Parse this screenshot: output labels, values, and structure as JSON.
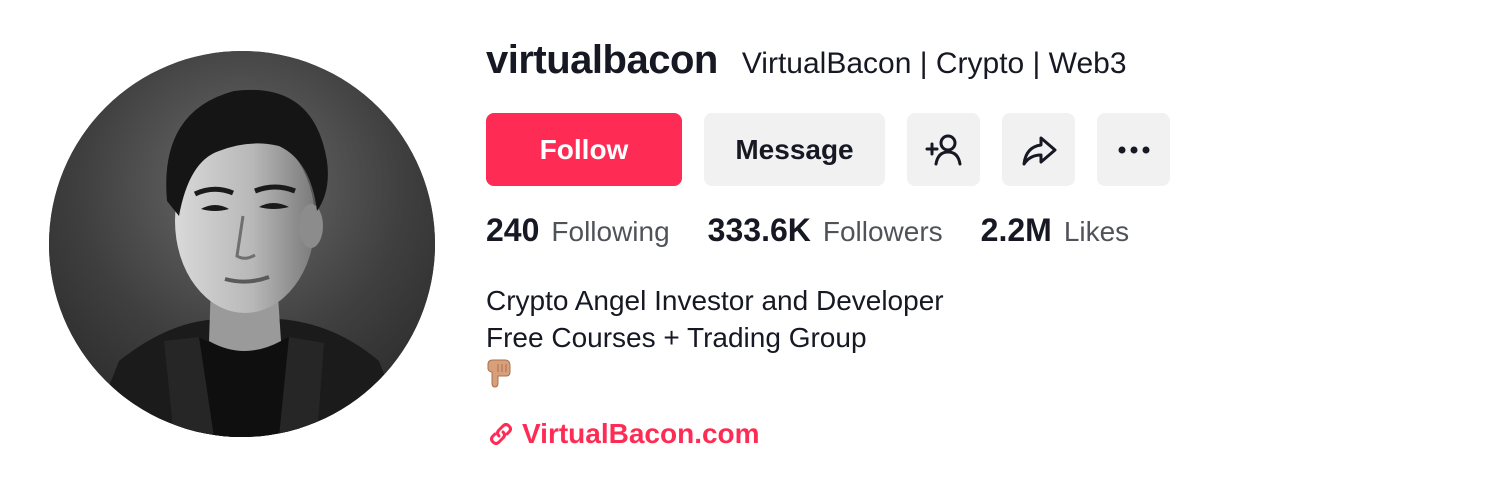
{
  "profile": {
    "username": "virtualbacon",
    "nickname": "VirtualBacon | Crypto | Web3",
    "avatar_icon": "profile-photo"
  },
  "actions": {
    "follow_label": "Follow",
    "message_label": "Message",
    "follow_color": "#fe2c55",
    "add_friend_icon": "add-user-icon",
    "share_icon": "share-icon",
    "more_icon": "more-icon"
  },
  "stats": {
    "following_count": "240",
    "following_label": "Following",
    "followers_count": "333.6K",
    "followers_label": "Followers",
    "likes_count": "2.2M",
    "likes_label": "Likes"
  },
  "bio": {
    "line1": "Crypto Angel Investor and Developer",
    "line2": "Free Courses + Trading Group",
    "pointer_icon": "pointing-down-emoji"
  },
  "link": {
    "text": "VirtualBacon.com",
    "icon": "link-icon"
  }
}
